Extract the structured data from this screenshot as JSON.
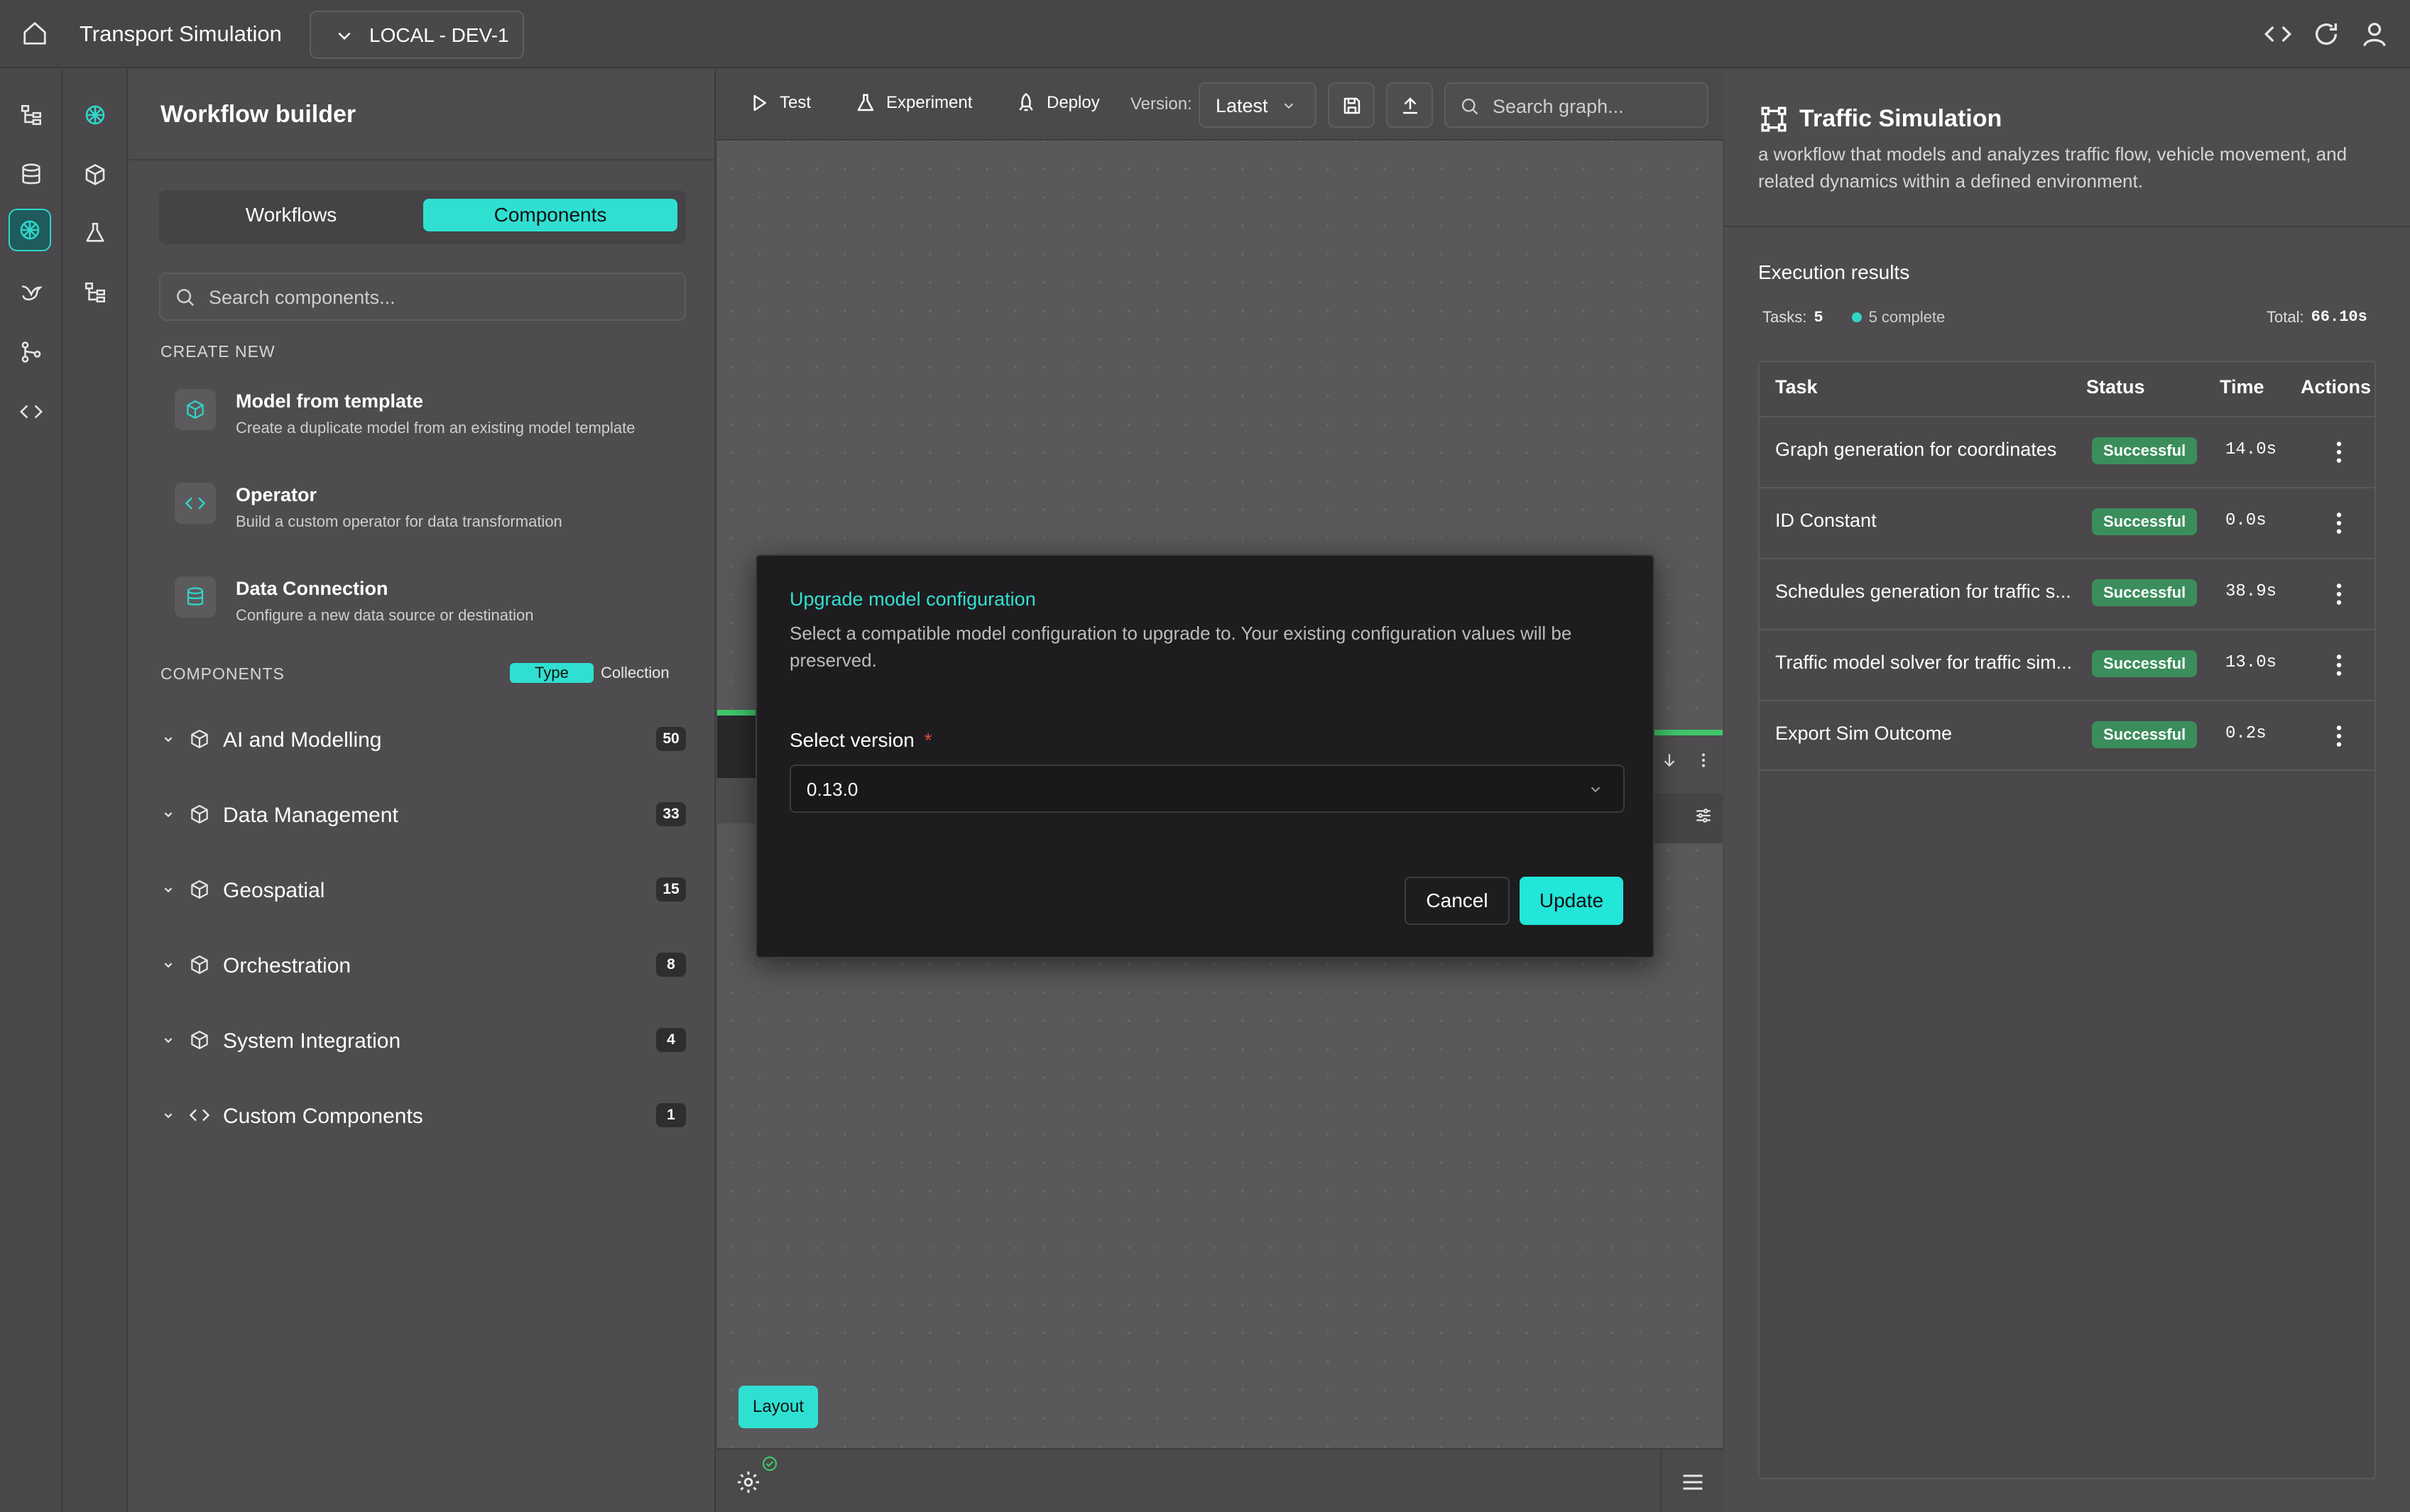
{
  "app": {
    "title": "Transport Simulation",
    "environment": "LOCAL - DEV-1"
  },
  "sidebar": {
    "title": "Workflow builder",
    "tabs": [
      "Workflows",
      "Components"
    ],
    "active_tab": "Components",
    "search_placeholder": "Search components...",
    "create_new_label": "CREATE NEW",
    "create_items": [
      {
        "title": "Model from template",
        "desc": "Create a duplicate model from an existing model template",
        "icon": "cube-icon"
      },
      {
        "title": "Operator",
        "desc": "Build a custom operator for data transformation",
        "icon": "code-icon"
      },
      {
        "title": "Data Connection",
        "desc": "Configure a new data source or destination",
        "icon": "database-icon"
      }
    ],
    "components_label": "COMPONENTS",
    "grouping": {
      "type": "Type",
      "collection": "Collection",
      "active": "Type"
    },
    "groups": [
      {
        "label": "AI and Modelling",
        "count": "50",
        "icon": "cube-icon"
      },
      {
        "label": "Data Management",
        "count": "33",
        "icon": "cube-icon"
      },
      {
        "label": "Geospatial",
        "count": "15",
        "icon": "cube-icon"
      },
      {
        "label": "Orchestration",
        "count": "8",
        "icon": "cube-icon"
      },
      {
        "label": "System Integration",
        "count": "4",
        "icon": "cube-icon"
      },
      {
        "label": "Custom Components",
        "count": "1",
        "icon": "code-icon"
      }
    ]
  },
  "toolbar": {
    "test": "Test",
    "experiment": "Experiment",
    "deploy": "Deploy",
    "version_label": "Version:",
    "version_value": "Latest",
    "search_placeholder": "Search graph..."
  },
  "canvas": {
    "layout_button": "Layout"
  },
  "modal": {
    "title": "Upgrade model configuration",
    "description": "Select a compatible model configuration to upgrade to. Your existing configuration values will be preserved.",
    "field_label": "Select version",
    "required_mark": "*",
    "selected_version": "0.13.0",
    "cancel": "Cancel",
    "update": "Update"
  },
  "details": {
    "title": "Traffic Simulation",
    "description": "a workflow that models and analyzes traffic flow, vehicle movement, and related dynamics within a defined environment.",
    "exec_title": "Execution results",
    "tasks_label": "Tasks:",
    "tasks_count": "5",
    "complete_text": "5 complete",
    "total_label": "Total:",
    "total_value": "66.10s",
    "columns": [
      "Task",
      "Status",
      "Time",
      "Actions"
    ],
    "rows": [
      {
        "task": "Graph generation for coordinates",
        "status": "Successful",
        "time": "14.0s"
      },
      {
        "task": "ID Constant",
        "status": "Successful",
        "time": "0.0s"
      },
      {
        "task": "Schedules generation for traffic s...",
        "status": "Successful",
        "time": "38.9s"
      },
      {
        "task": "Traffic model solver for traffic sim...",
        "status": "Successful",
        "time": "13.0s"
      },
      {
        "task": "Export Sim Outcome",
        "status": "Successful",
        "time": "0.2s"
      }
    ]
  },
  "colors": {
    "accent": "#21e6d8",
    "success": "#3b8e5c",
    "background": "#4a484a",
    "modal_bg": "#1e1c1e"
  }
}
